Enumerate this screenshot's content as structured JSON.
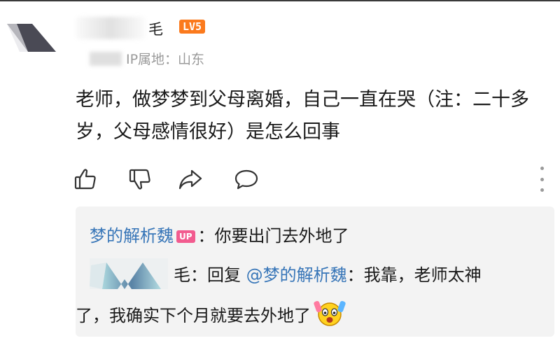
{
  "comment": {
    "username_visible": "毛",
    "level_badge": "LV5",
    "ip_location": "IP属地：山东",
    "text": "老师，做梦梦到父母离婚，自己一直在哭（注：二十多岁，父母感情很好）是怎么回事"
  },
  "actions": {
    "icons": [
      "thumbs-up-icon",
      "thumbs-down-icon",
      "share-icon",
      "comment-icon",
      "more-icon"
    ]
  },
  "replies": [
    {
      "author": "梦的解析魏",
      "badge": "UP",
      "separator": "：",
      "text": "你要出门去外地了"
    },
    {
      "author_visible": "毛",
      "separator": "：",
      "reply_prefix": "回复",
      "mention": "@梦的解析魏",
      "text_line1": "：我靠，老师太神",
      "text_line2": "了，我确实下个月就要去外地了",
      "emoji": "shocked-face-emoji"
    }
  ],
  "colors": {
    "link_blue": "#3876b8",
    "level_orange": "#fb7a1d",
    "up_pink": "#f25b8f",
    "meta_gray": "#9a9a9a",
    "reply_bg": "#f3f3f3"
  }
}
